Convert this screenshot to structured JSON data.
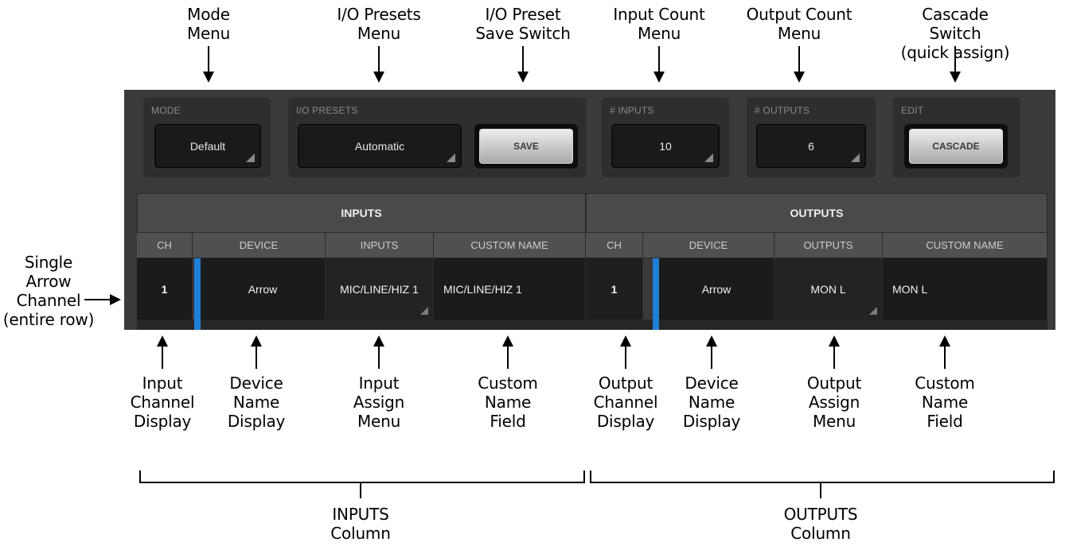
{
  "callouts_top": [
    {
      "text": "Mode\nMenu"
    },
    {
      "text": "I/O Presets\nMenu"
    },
    {
      "text": "I/O Preset\nSave Switch"
    },
    {
      "text": "Input Count\nMenu"
    },
    {
      "text": "Output Count\nMenu"
    },
    {
      "text": "Cascade Switch\n(quick assign)"
    }
  ],
  "callout_left": "Single\nArrow\nChannel\n(entire row)",
  "callouts_bottom": [
    {
      "text": "Input\nChannel\nDisplay"
    },
    {
      "text": "Device\nName\nDisplay"
    },
    {
      "text": "Input\nAssign\nMenu"
    },
    {
      "text": "Custom\nName\nField"
    },
    {
      "text": "Output\nChannel\nDisplay"
    },
    {
      "text": "Device\nName\nDisplay"
    },
    {
      "text": "Output\nAssign\nMenu"
    },
    {
      "text": "Custom\nName\nField"
    }
  ],
  "column_labels": {
    "inputs": "INPUTS\nColumn",
    "outputs": "OUTPUTS\nColumn"
  },
  "toolbar": {
    "mode": {
      "label": "MODE",
      "value": "Default"
    },
    "io_presets": {
      "label": "I/O PRESETS",
      "value": "Automatic",
      "save": "SAVE"
    },
    "inputs_count": {
      "label": "# INPUTS",
      "value": "10"
    },
    "outputs_count": {
      "label": "# OUTPUTS",
      "value": "6"
    },
    "edit": {
      "label": "EDIT",
      "cascade": "CASCADE"
    }
  },
  "table": {
    "inputs_header": "INPUTS",
    "outputs_header": "OUTPUTS",
    "input_columns": [
      "CH",
      "DEVICE",
      "INPUTS",
      "CUSTOM NAME"
    ],
    "output_columns": [
      "CH",
      "DEVICE",
      "OUTPUTS",
      "CUSTOM NAME"
    ],
    "row": {
      "in_ch": "1",
      "in_device": "Arrow",
      "in_assign": "MIC/LINE/HIZ 1",
      "in_name": "MIC/LINE/HIZ 1",
      "out_ch": "1",
      "out_device": "Arrow",
      "out_assign": "MON L",
      "out_name": "MON L"
    }
  },
  "colors": {
    "panel": "#3a3a3a",
    "device_accent": "#1e7fd6",
    "row_bg": "#1b1b1b"
  }
}
